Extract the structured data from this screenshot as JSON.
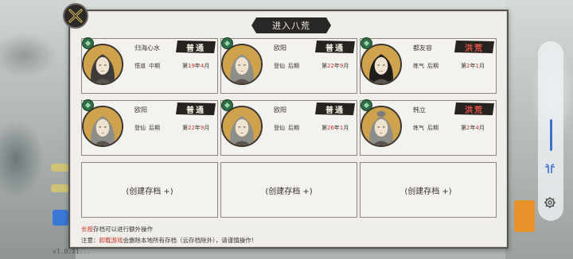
{
  "title": "进入八荒",
  "colors": {
    "panel": "#efeee8",
    "dark": "#2a2826",
    "accent_red": "#c4352c"
  },
  "slots": [
    {
      "name": "归海心水",
      "realm": "悟道",
      "stage": "中期",
      "date_prefix": "第",
      "year": "19",
      "year_unit": "年",
      "month": "4",
      "month_unit": "月",
      "mode": "普通",
      "hard": false,
      "hair": "long-dark"
    },
    {
      "name": "欧阳",
      "realm": "登仙",
      "stage": "后期",
      "date_prefix": "第",
      "year": "22",
      "year_unit": "年",
      "month": "9",
      "month_unit": "月",
      "mode": "普通",
      "hard": false,
      "hair": "grey"
    },
    {
      "name": "都友容",
      "realm": "练气",
      "stage": "后期",
      "date_prefix": "第",
      "year": "2",
      "year_unit": "年",
      "month": "1",
      "month_unit": "月",
      "mode": "洪荒",
      "hard": true,
      "hair": "female"
    },
    {
      "name": "欧阳",
      "realm": "登仙",
      "stage": "后期",
      "date_prefix": "第",
      "year": "22",
      "year_unit": "年",
      "month": "9",
      "month_unit": "月",
      "mode": "普通",
      "hard": false,
      "hair": "grey"
    },
    {
      "name": "欧阳",
      "realm": "登仙",
      "stage": "后期",
      "date_prefix": "第",
      "year": "26",
      "year_unit": "年",
      "month": "1",
      "month_unit": "月",
      "mode": "普通",
      "hard": false,
      "hair": "grey"
    },
    {
      "name": "韩立",
      "realm": "练气",
      "stage": "后期",
      "date_prefix": "第",
      "year": "2",
      "year_unit": "年",
      "month": "4",
      "month_unit": "月",
      "mode": "洪荒",
      "hard": true,
      "hair": "grey-bun"
    }
  ],
  "empty_slots": [
    {
      "label": "(创建存档 +)"
    },
    {
      "label": "(创建存档 +)"
    },
    {
      "label": "(创建存档 +)"
    }
  ],
  "notes": {
    "line1_red": "长按",
    "line1_rest": "存档可以进行额外操作",
    "line2_prefix": "注意：",
    "line2_red": "卸载游戏",
    "line2_rest": "会删除本地所有存档（云存档除外），请谨慎操作!"
  },
  "version": "v1.0.11...",
  "icons": {
    "close": "close-x-icon",
    "earbuds": "earbuds-icon",
    "settings": "gear-icon",
    "gem": "jade-gem-icon"
  }
}
